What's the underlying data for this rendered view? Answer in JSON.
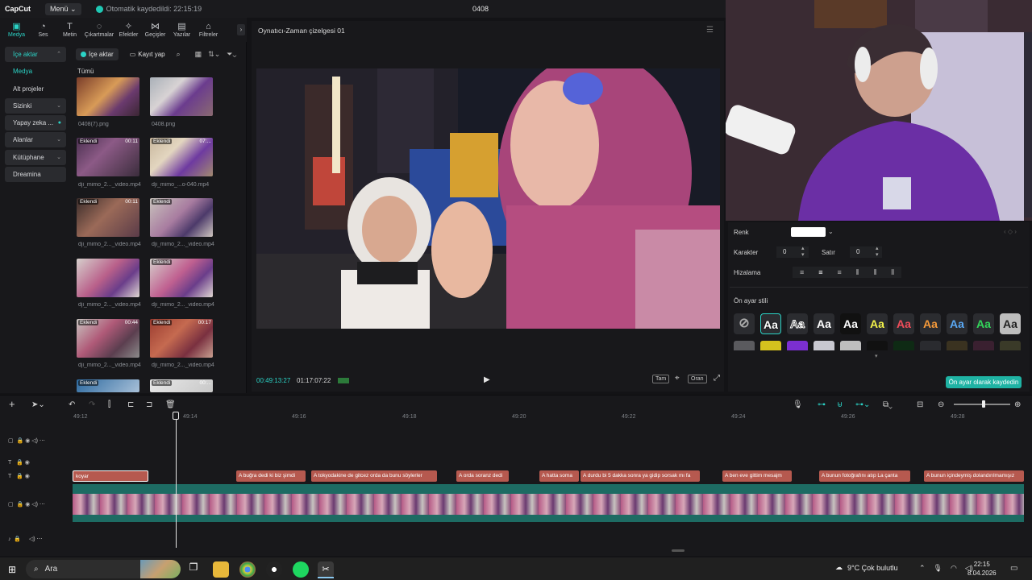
{
  "app": {
    "logo": "CapCut",
    "menu": "Menü",
    "autosave": "Otomatik kaydedildi: 22:15:19",
    "project_title": "0408"
  },
  "toolbar": [
    {
      "label": "Medya",
      "icon": "media-icon"
    },
    {
      "label": "Ses",
      "icon": "audio-icon"
    },
    {
      "label": "Metin",
      "icon": "text-icon"
    },
    {
      "label": "Çıkartmalar",
      "icon": "sticker-icon"
    },
    {
      "label": "Efektler",
      "icon": "effects-icon"
    },
    {
      "label": "Geçişler",
      "icon": "transitions-icon"
    },
    {
      "label": "Yazılar",
      "icon": "captions-icon"
    },
    {
      "label": "Filtreler",
      "icon": "filters-icon"
    }
  ],
  "sidebar": [
    {
      "label": "İçe aktar",
      "arrow": "⌃"
    },
    {
      "label": "Medya",
      "arrow": ""
    },
    {
      "label": "Alt projeler",
      "arrow": ""
    },
    {
      "label": "Sizinki",
      "arrow": "⌄"
    },
    {
      "label": "Yapay zeka ...",
      "arrow": "●"
    },
    {
      "label": "Alanlar",
      "arrow": "⌄"
    },
    {
      "label": "Kütüphane",
      "arrow": "⌄"
    },
    {
      "label": "Dreamina",
      "arrow": ""
    }
  ],
  "media": {
    "import_btn": "İçe aktar",
    "record_btn": "Kayıt yap",
    "section": "Tümü",
    "items": [
      {
        "name": "0408(7).png",
        "tag": "",
        "dur": ""
      },
      {
        "name": "0408.png",
        "tag": "",
        "dur": ""
      },
      {
        "name": "dji_mimo_2..._video.mp4",
        "tag": "Eklendi",
        "dur": "00:11"
      },
      {
        "name": "dji_mimo_...o-040.mp4",
        "tag": "Eklendi",
        "dur": "07:..."
      },
      {
        "name": "dji_mimo_2..._video.mp4",
        "tag": "Eklendi",
        "dur": "00:11"
      },
      {
        "name": "dji_mimo_2..._video.mp4",
        "tag": "Eklendi",
        "dur": ""
      },
      {
        "name": "dji_mimo_2..._video.mp4",
        "tag": "",
        "dur": ""
      },
      {
        "name": "dji_mimo_2..._video.mp4",
        "tag": "Eklendi",
        "dur": ""
      },
      {
        "name": "dji_mimo_2..._video.mp4",
        "tag": "Eklendi",
        "dur": "00:44"
      },
      {
        "name": "dji_mimo_2..._video.mp4",
        "tag": "Eklendi",
        "dur": "00:17"
      },
      {
        "name": "",
        "tag": "Eklendi",
        "dur": ""
      },
      {
        "name": "",
        "tag": "Eklendi",
        "dur": "00:..."
      }
    ]
  },
  "player": {
    "title": "Oynatıcı-Zaman çizelgesi 01",
    "current_time": "00:49:13:27",
    "total_time": "01:17:07:22",
    "fullscreen_label": "Tam",
    "ratio_label": "Oran"
  },
  "props": {
    "color_label": "Renk",
    "char_label": "Karakter",
    "char_value": "0",
    "line_label": "Satır",
    "line_value": "0",
    "align_label": "Hizalama",
    "preset_label": "Ön ayar stili",
    "preset_glyph": "Aa",
    "save_preset": "Ön ayar olarak kaydedin",
    "preset_colors": [
      "#ffffff",
      "#ffffff",
      "#ffffff",
      "#ffffff",
      "#f4f34a",
      "#f04d5a",
      "#f59a3a",
      "#5aa9f5",
      "#33d65a",
      "#dcdcdc"
    ]
  },
  "timeline": {
    "ruler": [
      "49:12",
      "49:14",
      "49:16",
      "49:18",
      "49:20",
      "49:22",
      "49:24",
      "49:26",
      "49:28"
    ],
    "text_clips": [
      {
        "text": "koyar"
      },
      {
        "text": "A buğra dedi ki biz şimdi"
      },
      {
        "text": "A tokyodakine de gitcez orda da bunu söylerler"
      },
      {
        "text": "A orda soranz dedi"
      },
      {
        "text": "A hatta soma"
      },
      {
        "text": "A durdu bi 5 dakka sonra ya gidip sorsak mı fa"
      },
      {
        "text": "A ben eve gittim mesajm"
      },
      {
        "text": "A bunun fotoğrafını atıp La çanta"
      },
      {
        "text": "A bunun içindeymiş dolandırılmamışız"
      }
    ]
  },
  "taskbar": {
    "search": "Ara",
    "weather": "9°C  Çok bulutlu",
    "time": "22:15",
    "date": "8.04.2026"
  }
}
